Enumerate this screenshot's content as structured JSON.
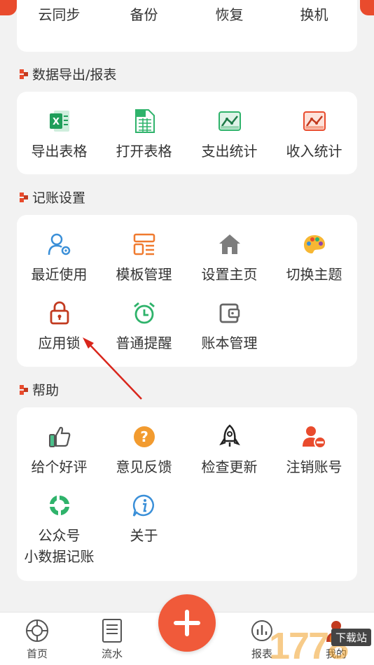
{
  "sync_section": {
    "items": [
      {
        "label": "云同步",
        "icon": "cloud-sync-icon"
      },
      {
        "label": "备份",
        "icon": "backup-icon"
      },
      {
        "label": "恢复",
        "icon": "restore-icon"
      },
      {
        "label": "换机",
        "icon": "switch-device-icon"
      }
    ]
  },
  "export_section": {
    "title": "数据导出/报表",
    "items": [
      {
        "label": "导出表格",
        "icon": "excel-icon"
      },
      {
        "label": "打开表格",
        "icon": "spreadsheet-icon"
      },
      {
        "label": "支出统计",
        "icon": "expense-chart-icon"
      },
      {
        "label": "收入统计",
        "icon": "income-chart-icon"
      }
    ]
  },
  "settings_section": {
    "title": "记账设置",
    "items": [
      {
        "label": "最近使用",
        "icon": "user-settings-icon"
      },
      {
        "label": "模板管理",
        "icon": "template-icon"
      },
      {
        "label": "设置主页",
        "icon": "home-icon"
      },
      {
        "label": "切换主题",
        "icon": "palette-icon"
      },
      {
        "label": "应用锁",
        "icon": "lock-icon"
      },
      {
        "label": "普通提醒",
        "icon": "alarm-clock-icon"
      },
      {
        "label": "账本管理",
        "icon": "wallet-icon"
      }
    ]
  },
  "help_section": {
    "title": "帮助",
    "items": [
      {
        "label": "给个好评",
        "icon": "thumbs-up-icon"
      },
      {
        "label": "意见反馈",
        "icon": "question-icon"
      },
      {
        "label": "检查更新",
        "icon": "rocket-icon"
      },
      {
        "label": "注销账号",
        "icon": "remove-user-icon"
      },
      {
        "label": "公众号",
        "icon": "wechat-official-icon"
      },
      {
        "label": "关于",
        "icon": "info-icon"
      }
    ],
    "official_account_name": "小数据记账"
  },
  "bottom_nav": {
    "tabs": [
      {
        "label": "首页",
        "icon": "home-tab-icon"
      },
      {
        "label": "流水",
        "icon": "ledger-tab-icon"
      },
      {
        "label": "报表",
        "icon": "report-tab-icon"
      },
      {
        "label": "我的",
        "icon": "profile-tab-icon"
      }
    ],
    "add_icon": "plus-icon"
  },
  "watermark": {
    "text": "下载站",
    "brand": "1778"
  },
  "colors": {
    "accent": "#e94b2d",
    "fab": "#f05a3a",
    "green": "#2fb36b",
    "blue": "#3a8fd8",
    "orange": "#f29b2f"
  }
}
